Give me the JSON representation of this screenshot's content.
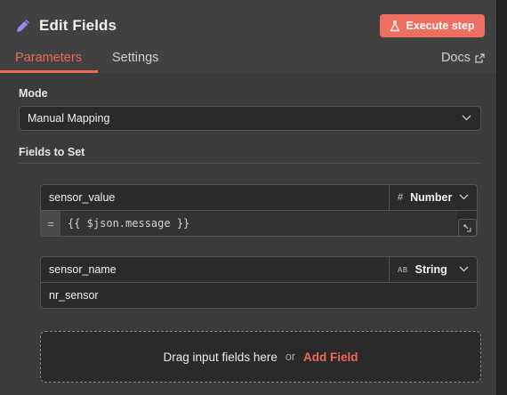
{
  "header": {
    "title": "Edit Fields",
    "execute_label": "Execute step",
    "accent": "#ee6f5f"
  },
  "tabs": [
    {
      "label": "Parameters",
      "active": true
    },
    {
      "label": "Settings",
      "active": false
    }
  ],
  "docs_label": "Docs",
  "mode": {
    "label": "Mode",
    "selected": "Manual Mapping"
  },
  "fields_to_set": {
    "label": "Fields to Set",
    "fields": [
      {
        "name": "sensor_value",
        "type_icon": "#",
        "type": "Number",
        "value": "{{ $json.message }}",
        "is_expression": true
      },
      {
        "name": "sensor_name",
        "type_icon": "AB",
        "type": "String",
        "value": "nr_sensor",
        "is_expression": false
      }
    ]
  },
  "dropzone": {
    "text": "Drag input fields here",
    "or": "or",
    "add_label": "Add Field"
  }
}
